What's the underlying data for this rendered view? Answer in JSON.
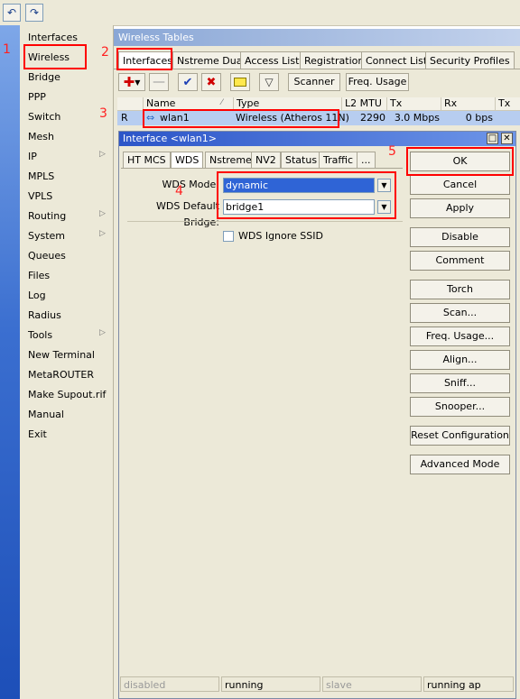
{
  "toolbar": {
    "undo_icon": "undo-icon",
    "redo_icon": "redo-icon"
  },
  "sidebar": {
    "items": [
      {
        "label": "Interfaces"
      },
      {
        "label": "Wireless"
      },
      {
        "label": "Bridge"
      },
      {
        "label": "PPP"
      },
      {
        "label": "Switch"
      },
      {
        "label": "Mesh"
      },
      {
        "label": "IP",
        "submenu": true
      },
      {
        "label": "MPLS"
      },
      {
        "label": "VPLS"
      },
      {
        "label": "Routing",
        "submenu": true
      },
      {
        "label": "System",
        "submenu": true
      },
      {
        "label": "Queues"
      },
      {
        "label": "Files"
      },
      {
        "label": "Log"
      },
      {
        "label": "Radius"
      },
      {
        "label": "Tools",
        "submenu": true
      },
      {
        "label": "New Terminal"
      },
      {
        "label": "MetaROUTER"
      },
      {
        "label": "Make Supout.rif"
      },
      {
        "label": "Manual"
      },
      {
        "label": "Exit"
      }
    ]
  },
  "window": {
    "title": "Wireless Tables",
    "tabs": [
      {
        "label": "Interfaces"
      },
      {
        "label": "Nstreme Dual"
      },
      {
        "label": "Access List"
      },
      {
        "label": "Registration"
      },
      {
        "label": "Connect List"
      },
      {
        "label": "Security Profiles"
      }
    ],
    "toolbar": {
      "scanner": "Scanner",
      "freq_usage": "Freq. Usage"
    },
    "columns": [
      "Name",
      "Type",
      "L2 MTU",
      "Tx",
      "Rx",
      "Tx Pa"
    ],
    "row": {
      "flag": "R",
      "name": "wlan1",
      "type": "Wireless (Atheros 11N)",
      "l2mtu": "2290",
      "tx": "3.0 Mbps",
      "rx": "0 bps"
    }
  },
  "dialog": {
    "title": "Interface <wlan1>",
    "tabs": [
      {
        "label": "HT MCS"
      },
      {
        "label": "WDS"
      },
      {
        "label": "Nstreme"
      },
      {
        "label": "NV2"
      },
      {
        "label": "Status"
      },
      {
        "label": "Traffic"
      },
      {
        "label": "..."
      }
    ],
    "wds_mode_label": "WDS Mode:",
    "wds_mode_value": "dynamic",
    "wds_bridge_label": "WDS Default Bridge:",
    "wds_bridge_value": "bridge1",
    "wds_ignore_ssid_label": "WDS Ignore SSID",
    "buttons": {
      "ok": "OK",
      "cancel": "Cancel",
      "apply": "Apply",
      "disable": "Disable",
      "comment": "Comment",
      "torch": "Torch",
      "scan": "Scan...",
      "freq_usage": "Freq. Usage...",
      "align": "Align...",
      "sniff": "Sniff...",
      "snooper": "Snooper...",
      "reset": "Reset Configuration",
      "advanced": "Advanced Mode"
    },
    "status": [
      "disabled",
      "running",
      "slave",
      "running ap"
    ]
  },
  "annotations": {
    "n1": "1",
    "n2": "2",
    "n3": "3",
    "n4": "4",
    "n5": "5"
  },
  "colors": {
    "highlight": "#ff0000",
    "title_blue": "#2c55c8",
    "selected_row": "#b7cdf0"
  }
}
